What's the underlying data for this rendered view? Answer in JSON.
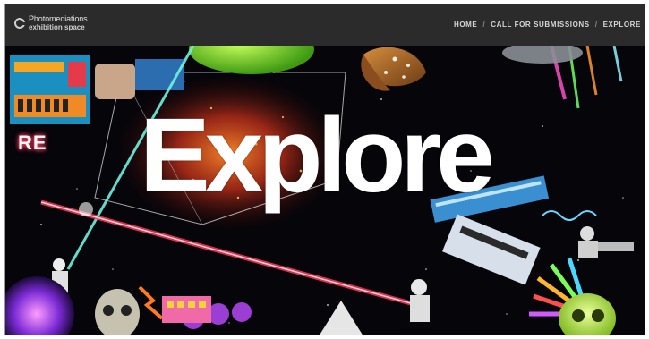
{
  "brand": {
    "line1": "Photomediations",
    "line2": "exhibition space",
    "icon": "logo-ring-icon"
  },
  "nav": {
    "items": [
      {
        "label": "HOME"
      },
      {
        "label": "CALL FOR SUBMISSIONS"
      },
      {
        "label": "EXPLORE"
      }
    ],
    "separator": "/"
  },
  "hero": {
    "title": "Explore",
    "collage_text": "RE"
  },
  "colors": {
    "topbar": "#2b2b2b",
    "hero_bg": "#05050a",
    "laser_red": "#ff3b5c",
    "laser_cyan": "#6ef2e0"
  }
}
